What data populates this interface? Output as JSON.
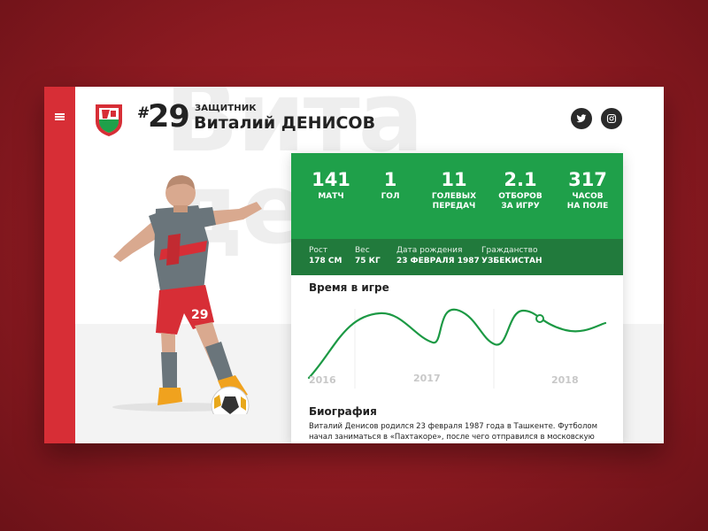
{
  "background_text": "Вита\nде",
  "player": {
    "number_prefix": "#",
    "number": "29",
    "position": "ЗАЩИТНИК",
    "name": "Виталий ДЕНИСОВ"
  },
  "social": {
    "twitter": "twitter-icon",
    "instagram": "instagram-icon"
  },
  "stats": [
    {
      "value": "141",
      "label": "МАТЧ"
    },
    {
      "value": "1",
      "label": "ГОЛ"
    },
    {
      "value": "11",
      "label": "ГОЛЕВЫХ\nПЕРЕДАЧ"
    },
    {
      "value": "2.1",
      "label": "ОТБОРОВ\nЗА ИГРУ"
    },
    {
      "value": "317",
      "label": "ЧАСОВ\nНА ПОЛЕ"
    }
  ],
  "info": [
    {
      "label": "Рост",
      "value": "178 СМ"
    },
    {
      "label": "Вес",
      "value": "75 КГ"
    },
    {
      "label": "Дата рождения",
      "value": "23 ФЕВРАЛЯ 1987"
    },
    {
      "label": "Гражданство",
      "value": "УЗБЕКИСТАН"
    }
  ],
  "playtime": {
    "title": "Время в игре",
    "years": [
      "2016",
      "2017",
      "2018"
    ]
  },
  "bio": {
    "title": "Биография",
    "text": "Виталий Денисов родился 23 февраля 1987 года в Ташкенте. Футболом начал заниматься в «Пахтакоре», после чего отправился в московскую «Академику»."
  },
  "colors": {
    "brand_red": "#d72e36",
    "stats_green": "#1fa04a",
    "info_green": "#217a3c",
    "line_green": "#1c9944"
  }
}
